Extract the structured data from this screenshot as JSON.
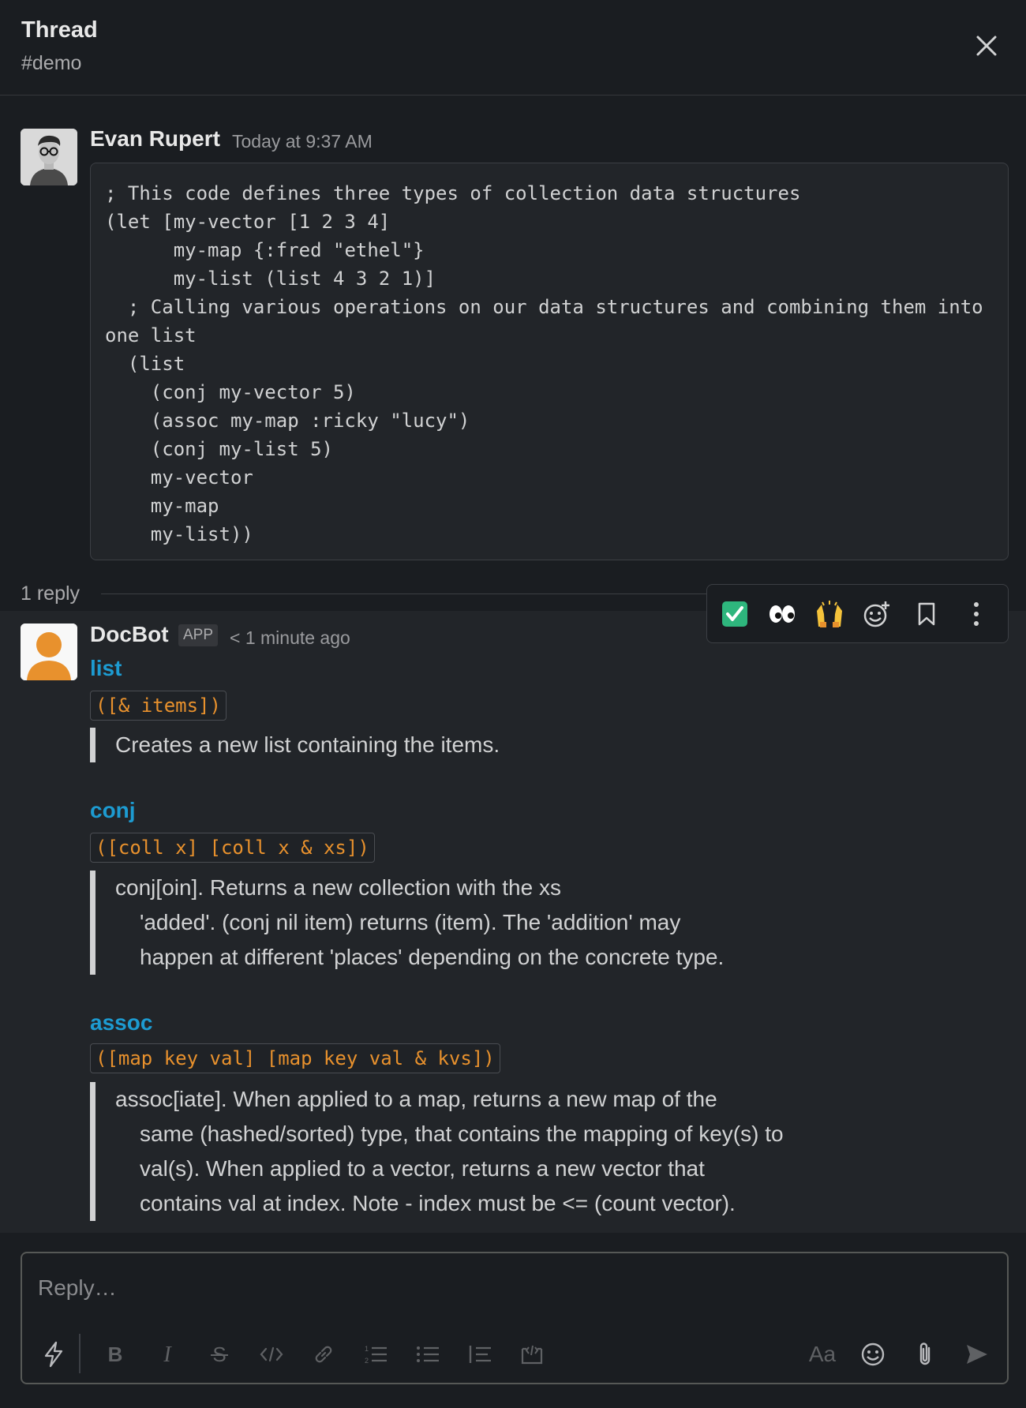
{
  "header": {
    "title": "Thread",
    "channel": "#demo"
  },
  "message": {
    "author": "Evan Rupert",
    "timestamp": "Today at 9:37 AM",
    "code": "; This code defines three types of collection data structures\n(let [my-vector [1 2 3 4]\n      my-map {:fred \"ethel\"}\n      my-list (list 4 3 2 1)]\n  ; Calling various operations on our data structures and combining them into one list\n  (list\n    (conj my-vector 5)\n    (assoc my-map :ricky \"lucy\")\n    (conj my-list 5)\n    my-vector\n    my-map\n    my-list))"
  },
  "replies": {
    "count_label": "1 reply"
  },
  "reply": {
    "author": "DocBot",
    "badge": "APP",
    "timestamp": "< 1 minute ago",
    "entries": [
      {
        "name": "list",
        "signature": "([& items])",
        "lines": [
          "Creates a new list containing the items."
        ]
      },
      {
        "name": "conj",
        "signature": "([coll x] [coll x & xs])",
        "lines": [
          "conj[oin]. Returns a new collection with the xs",
          "'added'. (conj nil item) returns (item).  The 'addition' may",
          "happen at different 'places' depending on the concrete type."
        ]
      },
      {
        "name": "assoc",
        "signature": "([map key val] [map key val & kvs])",
        "lines": [
          "assoc[iate]. When applied to a map, returns a new map of the",
          "same (hashed/sorted) type, that contains the mapping of key(s) to",
          "val(s). When applied to a vector, returns a new vector that",
          "contains val at index. Note - index must be <= (count vector)."
        ]
      }
    ]
  },
  "hover_actions": {
    "check": "✅",
    "eyes": "👀",
    "hands": "🙌"
  },
  "composer": {
    "placeholder": "Reply…",
    "text_format": "Aa"
  },
  "colors": {
    "background": "#1a1d21",
    "link": "#1d9bd1",
    "code_orange": "#e8912d",
    "avatar_orange": "#e8912d"
  }
}
